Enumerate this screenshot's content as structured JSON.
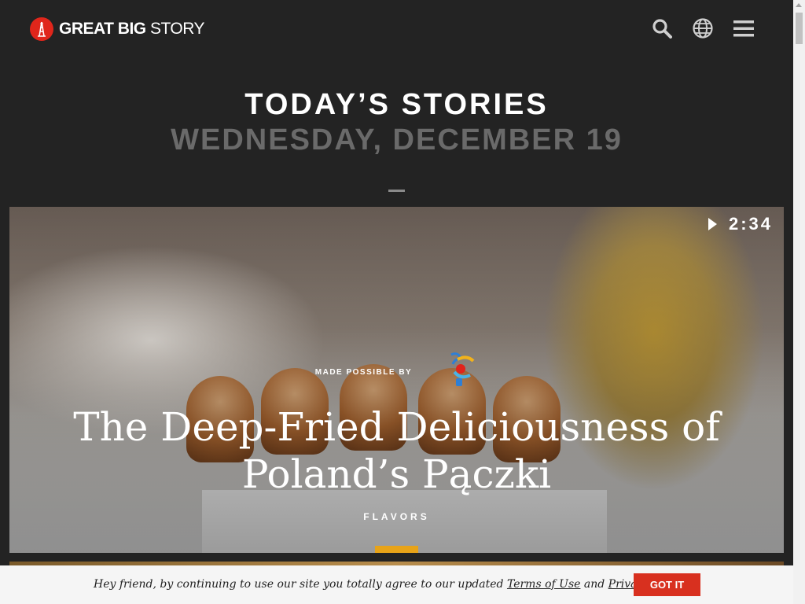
{
  "header": {
    "logo_bold": "GREAT BIG",
    "logo_light": "STORY",
    "icons": [
      "search-icon",
      "globe-icon",
      "menu-icon"
    ]
  },
  "section": {
    "title": "TODAY’S STORIES",
    "date": "WEDNESDAY, DECEMBER 19"
  },
  "hero": {
    "duration": "2:34",
    "sponsor_label": "MADE POSSIBLE BY",
    "title_line1": "The Deep-Fried Deliciousness of",
    "title_line2": "Poland’s Pączki",
    "category": "FLAVORS"
  },
  "cookie": {
    "text_before": "Hey friend, by continuing to use our site you totally agree to our updated",
    "terms_link": "Terms of Use",
    "and": "and",
    "privacy_link": "Privacy Policy",
    "button": "GOT IT"
  },
  "colors": {
    "brand_red": "#e0261b",
    "background": "#232323",
    "accent_orange": "#e7a318",
    "button_red": "#d8301f"
  }
}
